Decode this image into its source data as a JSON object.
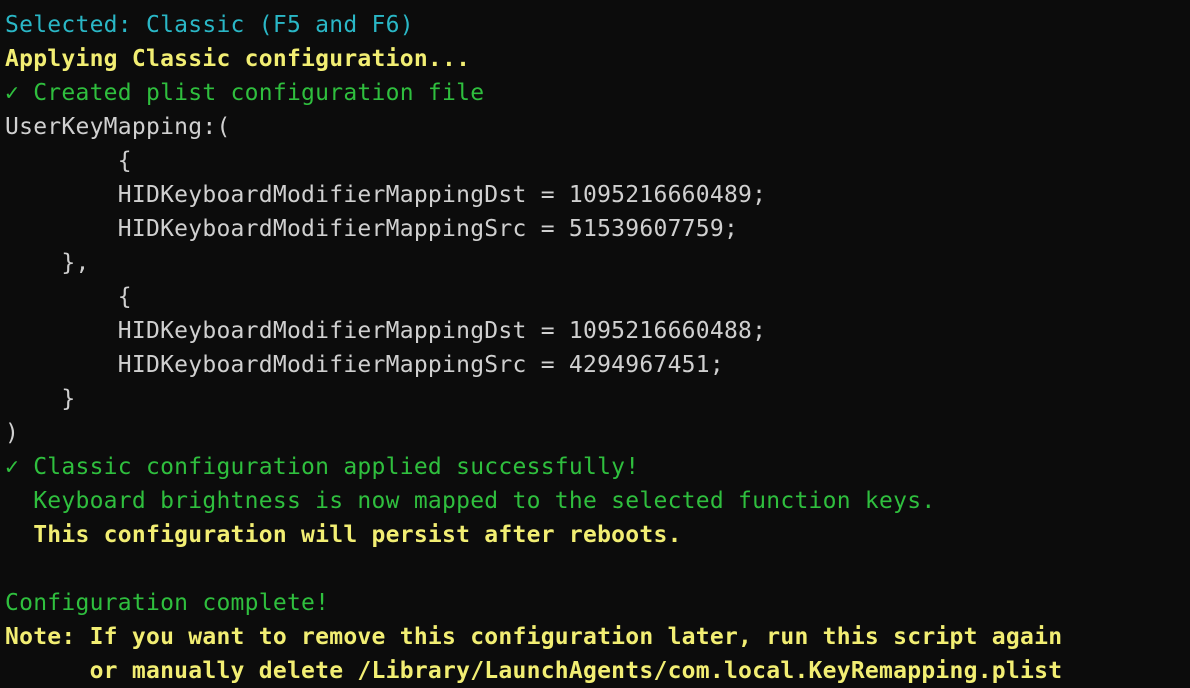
{
  "terminal": {
    "lines": [
      {
        "text": "Selected: Classic (F5 and F6)",
        "color": "cyan"
      },
      {
        "text": "Applying Classic configuration...",
        "color": "yellow"
      },
      {
        "text": "✓ Created plist configuration file",
        "color": "green"
      },
      {
        "text": "UserKeyMapping:(",
        "color": "white"
      },
      {
        "text": "        {",
        "color": "white"
      },
      {
        "text": "        HIDKeyboardModifierMappingDst = 1095216660489;",
        "color": "white"
      },
      {
        "text": "        HIDKeyboardModifierMappingSrc = 51539607759;",
        "color": "white"
      },
      {
        "text": "    },",
        "color": "white"
      },
      {
        "text": "        {",
        "color": "white"
      },
      {
        "text": "        HIDKeyboardModifierMappingDst = 1095216660488;",
        "color": "white"
      },
      {
        "text": "        HIDKeyboardModifierMappingSrc = 4294967451;",
        "color": "white"
      },
      {
        "text": "    }",
        "color": "white"
      },
      {
        "text": ")",
        "color": "white"
      },
      {
        "text": "✓ Classic configuration applied successfully!",
        "color": "green"
      },
      {
        "text": "  Keyboard brightness is now mapped to the selected function keys.",
        "color": "green"
      },
      {
        "text": "  This configuration will persist after reboots.",
        "color": "yellow"
      },
      {
        "text": "",
        "color": "white"
      },
      {
        "text": "Configuration complete!",
        "color": "green"
      },
      {
        "text": "Note: If you want to remove this configuration later, run this script again",
        "color": "yellow"
      },
      {
        "text": "      or manually delete /Library/LaunchAgents/com.local.KeyRemapping.plist",
        "color": "yellow"
      }
    ],
    "colors": {
      "background": "#0c0c0c",
      "cyan": "#2ab7c6",
      "yellow": "#f2ee73",
      "green": "#2fbf3e",
      "white": "#d0d0d0"
    }
  }
}
